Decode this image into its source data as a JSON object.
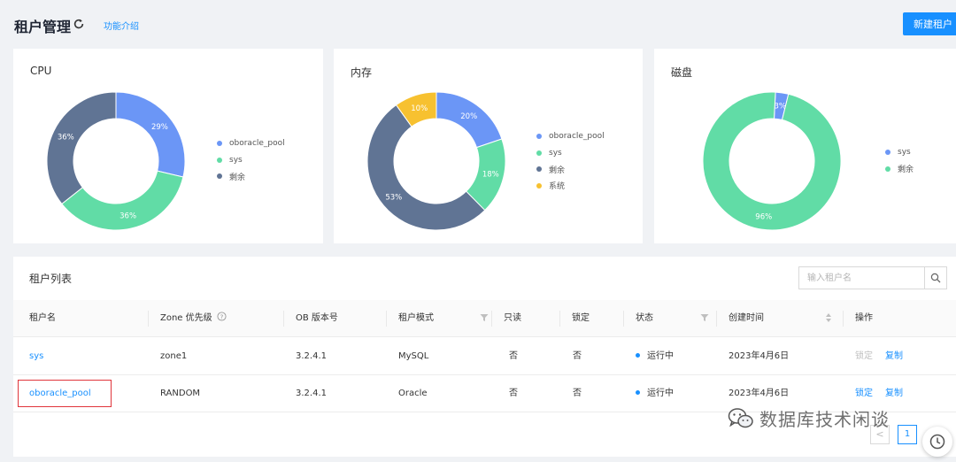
{
  "header": {
    "title": "租户管理",
    "intro_link": "功能介绍",
    "new_tenant_button": "新建租户"
  },
  "cards": [
    {
      "title": "CPU",
      "slices": [
        {
          "name": "oboracle_pool",
          "value": 29,
          "label": "29%",
          "color": "#6b96f6"
        },
        {
          "name": "sys",
          "value": 36,
          "label": "36%",
          "color": "#61dca6"
        },
        {
          "name": "剩余",
          "value": 36,
          "label": "36%",
          "color": "#607494"
        }
      ],
      "legend": [
        {
          "label": "oboracle_pool",
          "color": "#6b96f6"
        },
        {
          "label": "sys",
          "color": "#61dca6"
        },
        {
          "label": "剩余",
          "color": "#607494"
        }
      ]
    },
    {
      "title": "内存",
      "slices": [
        {
          "name": "oboracle_pool",
          "value": 20,
          "label": "20%",
          "color": "#6b96f6"
        },
        {
          "name": "sys",
          "value": 18,
          "label": "18%",
          "color": "#61dca6"
        },
        {
          "name": "剩余",
          "value": 53,
          "label": "53%",
          "color": "#607494"
        },
        {
          "name": "系统",
          "value": 10,
          "label": "10%",
          "color": "#f7c130"
        }
      ],
      "legend": [
        {
          "label": "oboracle_pool",
          "color": "#6b96f6"
        },
        {
          "label": "sys",
          "color": "#61dca6"
        },
        {
          "label": "剩余",
          "color": "#607494"
        },
        {
          "label": "系统",
          "color": "#f7c130"
        }
      ]
    },
    {
      "title": "磁盘",
      "slices": [
        {
          "name": "sys",
          "value": 3,
          "label": "3%",
          "color": "#6b96f6"
        },
        {
          "name": "剩余",
          "value": 96,
          "label": "96%",
          "color": "#61dca6"
        }
      ],
      "legend": [
        {
          "label": "sys",
          "color": "#6b96f6"
        },
        {
          "label": "剩余",
          "color": "#61dca6"
        }
      ]
    }
  ],
  "tenant_list": {
    "title": "租户列表",
    "search_placeholder": "输入租户名",
    "columns": [
      "租户名",
      "Zone 优先级",
      "OB 版本号",
      "租户模式",
      "只读",
      "锁定",
      "状态",
      "创建时间",
      "操作"
    ],
    "rows": [
      {
        "name": "sys",
        "zone": "zone1",
        "version": "3.2.4.1",
        "mode": "MySQL",
        "readonly": "否",
        "locked": "否",
        "status": "运行中",
        "created": "2023年4月6日",
        "action_lock": "锁定",
        "action_copy": "复制",
        "lock_enabled": false
      },
      {
        "name": "oboracle_pool",
        "zone": "RANDOM",
        "version": "3.2.4.1",
        "mode": "Oracle",
        "readonly": "否",
        "locked": "否",
        "status": "运行中",
        "created": "2023年4月6日",
        "action_lock": "锁定",
        "action_copy": "复制",
        "lock_enabled": true
      }
    ],
    "pagination": {
      "prev": "<",
      "current_page": "1"
    }
  },
  "watermark": "数据库技术闲谈"
}
